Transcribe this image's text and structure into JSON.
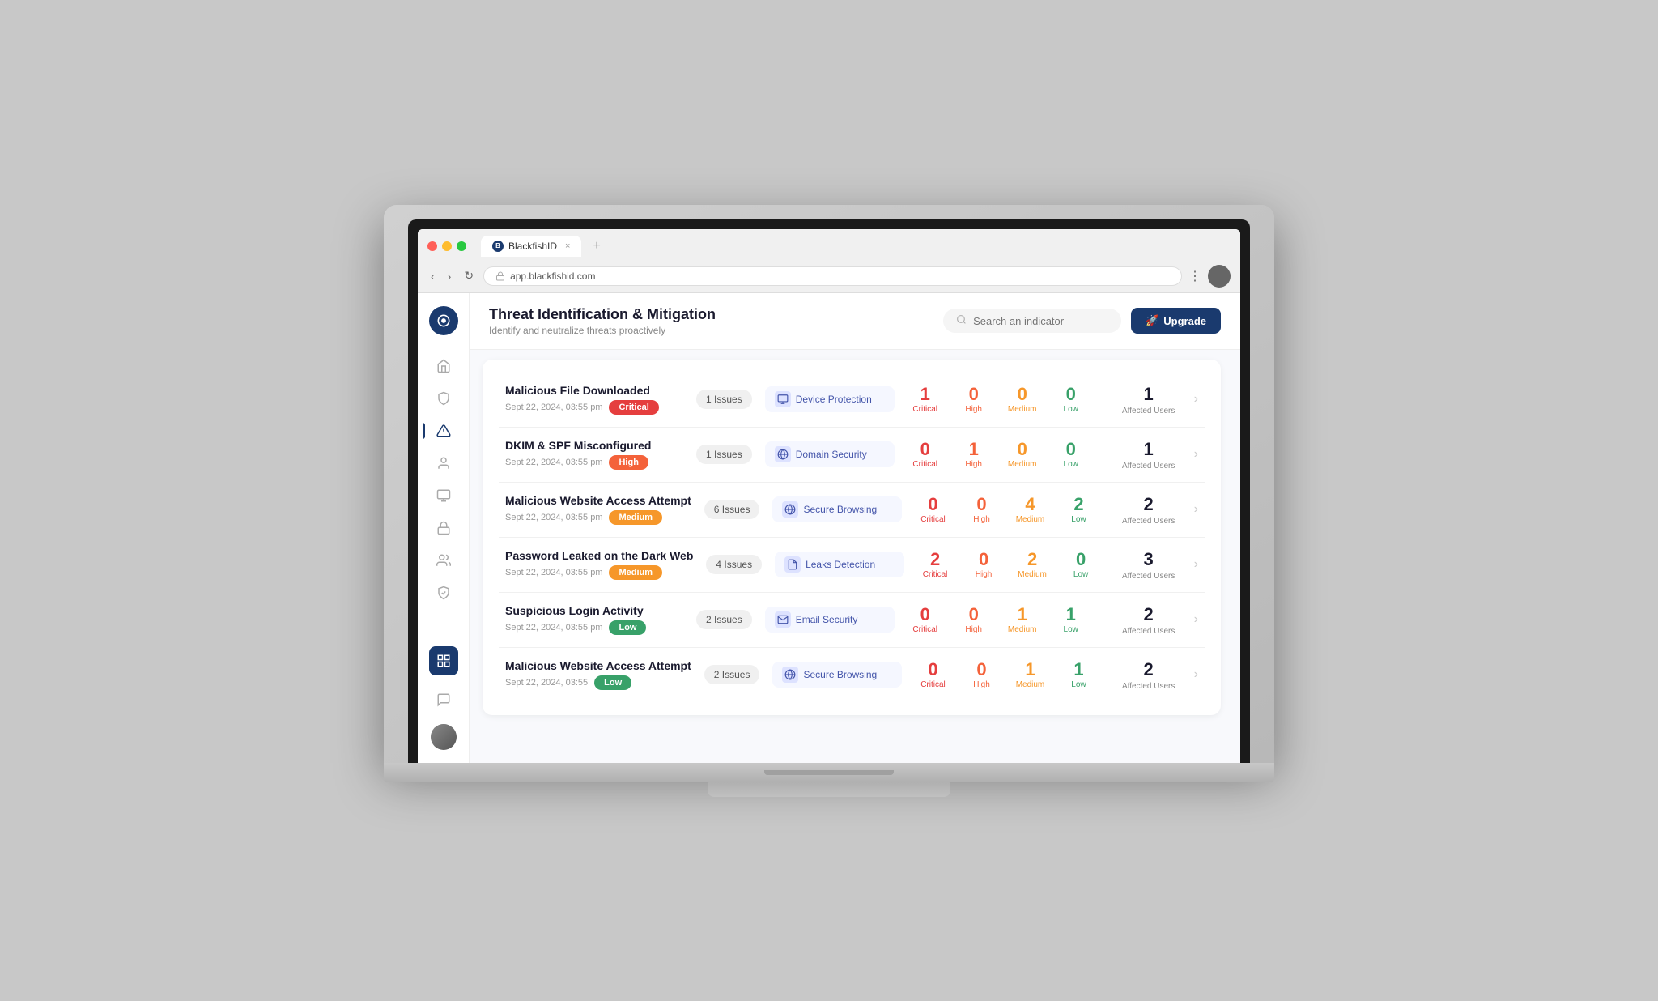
{
  "browser": {
    "url": "app.blackfishid.com",
    "tab_title": "BlackfishID",
    "tab_close": "×",
    "tab_new": "+",
    "nav_back": "‹",
    "nav_forward": "›",
    "nav_refresh": "↻",
    "menu_dots": "⋮"
  },
  "header": {
    "title": "Threat Identification & Mitigation",
    "subtitle": "Identify and neutralize threats proactively",
    "search_placeholder": "Search an indicator",
    "upgrade_label": "Upgrade",
    "upgrade_icon": "🚀"
  },
  "sidebar": {
    "items": [
      {
        "name": "home",
        "icon": "⌂",
        "active": false
      },
      {
        "name": "shield",
        "icon": "🛡",
        "active": false
      },
      {
        "name": "alert",
        "icon": "⚠",
        "active": true
      },
      {
        "name": "user",
        "icon": "👤",
        "active": false
      },
      {
        "name": "device",
        "icon": "🖥",
        "active": false
      },
      {
        "name": "lock",
        "icon": "🔒",
        "active": false
      },
      {
        "name": "monitor",
        "icon": "📊",
        "active": false
      },
      {
        "name": "security",
        "icon": "🔐",
        "active": false
      },
      {
        "name": "analytics",
        "icon": "📈",
        "active": true,
        "active_bg": true
      },
      {
        "name": "support",
        "icon": "💬",
        "active": false
      }
    ]
  },
  "threats": [
    {
      "id": 1,
      "name": "Malicious File Downloaded",
      "date": "Sept 22, 2024, 03:55 pm",
      "severity": "Critical",
      "severity_class": "badge-critical",
      "issues_count": "1 Issues",
      "category": "Device Protection",
      "category_icon": "🖥",
      "critical": 1,
      "high": 0,
      "medium": 0,
      "low": 0,
      "affected_users": 1
    },
    {
      "id": 2,
      "name": "DKIM & SPF Misconfigured",
      "date": "Sept 22, 2024, 03:55 pm",
      "severity": "High",
      "severity_class": "badge-high",
      "issues_count": "1 Issues",
      "category": "Domain Security",
      "category_icon": "🌐",
      "critical": 0,
      "high": 1,
      "medium": 0,
      "low": 0,
      "affected_users": 1
    },
    {
      "id": 3,
      "name": "Malicious Website Access Attempt",
      "date": "Sept 22, 2024, 03:55 pm",
      "severity": "Medium",
      "severity_class": "badge-medium",
      "issues_count": "6 Issues",
      "category": "Secure Browsing",
      "category_icon": "🌐",
      "critical": 0,
      "high": 0,
      "medium": 4,
      "low": 2,
      "affected_users": 2
    },
    {
      "id": 4,
      "name": "Password Leaked on the Dark Web",
      "date": "Sept 22, 2024, 03:55 pm",
      "severity": "Medium",
      "severity_class": "badge-medium",
      "issues_count": "4 Issues",
      "category": "Leaks Detection",
      "category_icon": "📋",
      "critical": 2,
      "high": 0,
      "medium": 2,
      "low": 0,
      "affected_users": 3
    },
    {
      "id": 5,
      "name": "Suspicious Login Activity",
      "date": "Sept 22, 2024, 03:55 pm",
      "severity": "Low",
      "severity_class": "badge-low",
      "issues_count": "2 Issues",
      "category": "Email Security",
      "category_icon": "📧",
      "critical": 0,
      "high": 0,
      "medium": 1,
      "low": 1,
      "affected_users": 2
    },
    {
      "id": 6,
      "name": "Malicious Website Access Attempt",
      "date": "Sept 22, 2024, 03:55",
      "severity": "Low",
      "severity_class": "badge-low",
      "issues_count": "2 Issues",
      "category": "Secure Browsing",
      "category_icon": "🌐",
      "critical": 0,
      "high": 0,
      "medium": 1,
      "low": 1,
      "affected_users": 2
    }
  ],
  "labels": {
    "critical": "Critical",
    "high": "High",
    "medium": "Medium",
    "low": "Low",
    "affected_users": "Affected Users"
  }
}
